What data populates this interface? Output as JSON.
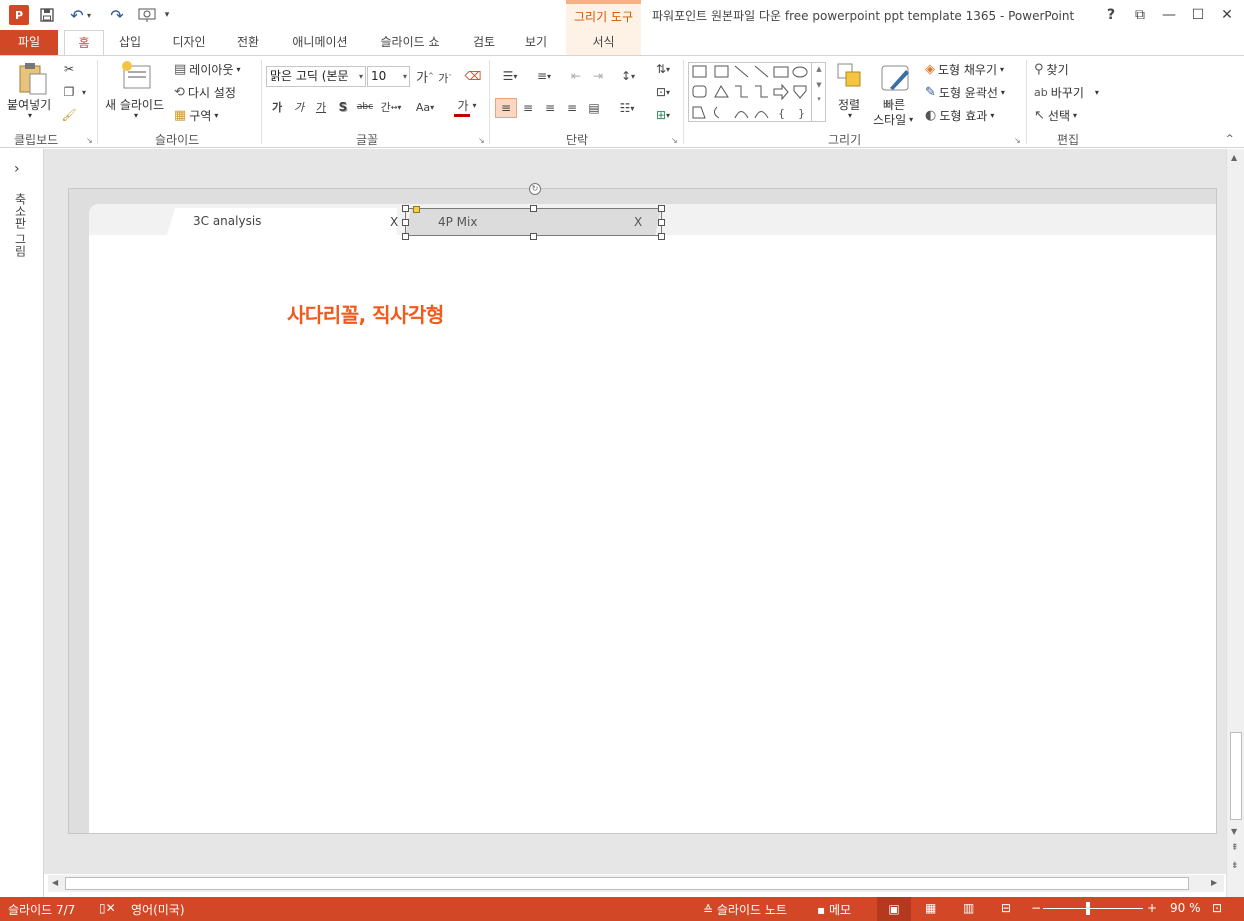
{
  "window": {
    "title": "파워포인트 원본파일 다운 free powerpoint ppt template 1365 - PowerPoint",
    "context_tool": "그리기 도구",
    "help": "?",
    "controls": [
      "⧉",
      "—",
      "☐",
      "✕"
    ]
  },
  "qat": {
    "logo": "P",
    "save_icon": "save-icon",
    "undo": "↶",
    "redo": "↷",
    "more": "▾"
  },
  "tabs": [
    "파일",
    "홈",
    "삽입",
    "디자인",
    "전환",
    "애니메이션",
    "슬라이드 쇼",
    "검토",
    "보기",
    "서식"
  ],
  "ribbon": {
    "clipboard": {
      "label": "클립보드",
      "paste": "붙여넣기"
    },
    "slides": {
      "label": "슬라이드",
      "new_slide": "새 슬라이드",
      "layout": "레이아웃",
      "reset": "다시 설정",
      "section": "구역"
    },
    "font": {
      "label": "글꼴",
      "font_name": "맑은 고딕 (본문",
      "font_size": "10",
      "grow": "가",
      "shrink": "가",
      "bold": "가",
      "italic": "가",
      "underline": "가",
      "shadow": "S",
      "strike": "abc",
      "spacing": "간",
      "case": "Aa",
      "color": "가"
    },
    "paragraph": {
      "label": "단락"
    },
    "drawing": {
      "label": "그리기",
      "arrange": "정렬",
      "quick_styles": "빠른\n스타일",
      "quick1": "빠른",
      "quick2": "스타일",
      "fill": "도형 채우기",
      "outline": "도형 윤곽선",
      "effects": "도형 효과"
    },
    "editing": {
      "label": "편집",
      "find": "찾기",
      "replace": "바꾸기",
      "select": "선택"
    }
  },
  "thumbnail_pane": {
    "label": "축소판 그림",
    "expand": "›"
  },
  "slide": {
    "tab1": {
      "label": "3C analysis",
      "close": "X"
    },
    "tab2": {
      "label": "4P Mix",
      "close": "X"
    },
    "heading": "사다리꼴, 직사각형"
  },
  "status": {
    "slide": "슬라이드 7/7",
    "language": "영어(미국)",
    "notes": "슬라이드 노트",
    "comments": "메모",
    "zoom_minus": "−",
    "zoom_plus": "+",
    "zoom": "90 %"
  }
}
